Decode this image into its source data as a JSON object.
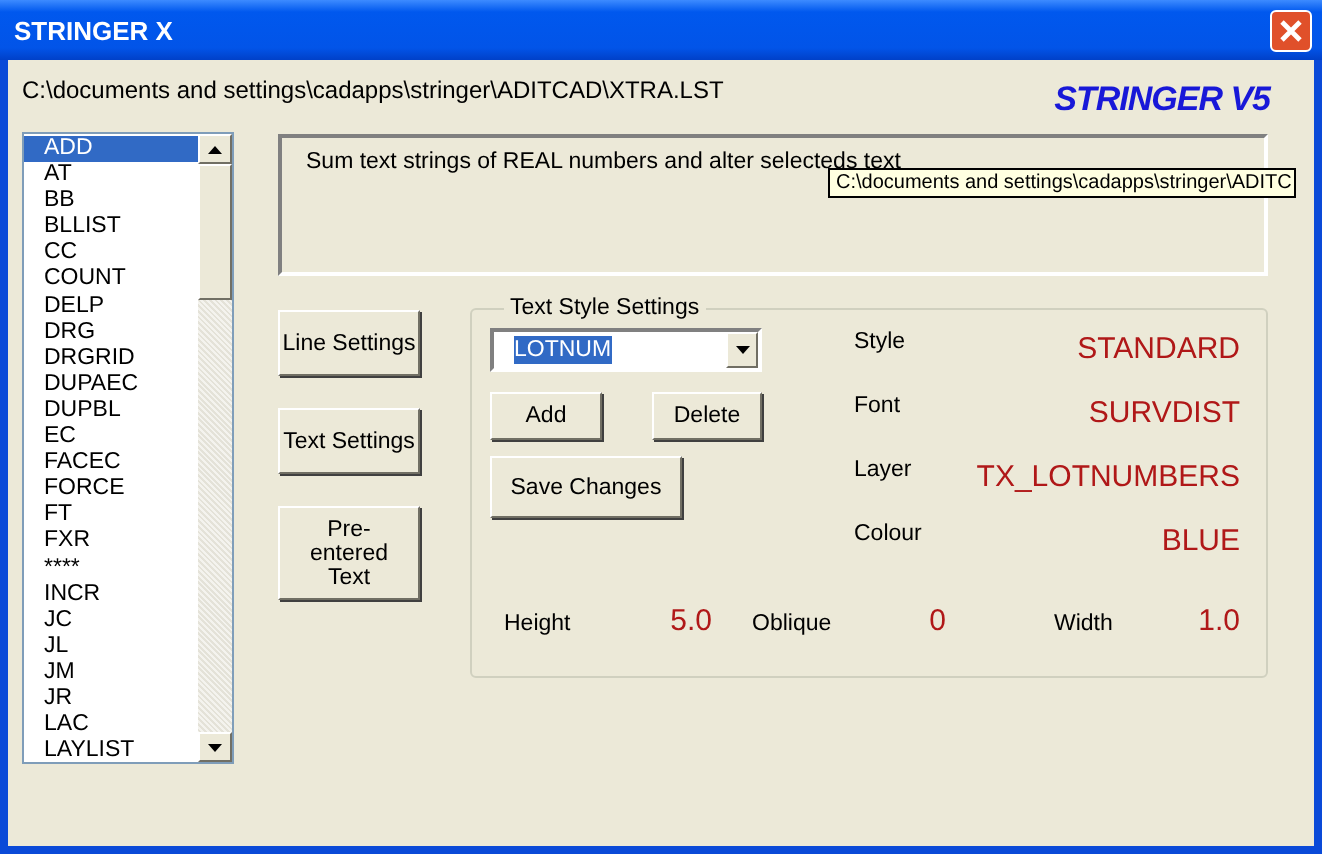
{
  "window": {
    "title": "STRINGER X"
  },
  "file_path": "C:\\documents and settings\\cadapps\\stringer\\ADITCAD\\XTRA.LST",
  "logo": "STRINGER V5",
  "commands": [
    {
      "label": "ADD",
      "selected": true
    },
    {
      "label": "AT",
      "selected": false
    },
    {
      "label": "BB",
      "selected": false
    },
    {
      "label": "BLLIST",
      "selected": false
    },
    {
      "label": "CC",
      "selected": false
    },
    {
      "label": "COUNT",
      "selected": false
    },
    {
      "label": "DELP",
      "selected": false
    },
    {
      "label": "DRG",
      "selected": false
    },
    {
      "label": "DRGRID",
      "selected": false
    },
    {
      "label": "DUPAEC",
      "selected": false
    },
    {
      "label": "DUPBL",
      "selected": false
    },
    {
      "label": "EC",
      "selected": false
    },
    {
      "label": "FACEC",
      "selected": false
    },
    {
      "label": "FORCE",
      "selected": false
    },
    {
      "label": "FT",
      "selected": false
    },
    {
      "label": "FXR",
      "selected": false
    },
    {
      "label": "****",
      "selected": false
    },
    {
      "label": "INCR",
      "selected": false
    },
    {
      "label": "JC",
      "selected": false
    },
    {
      "label": "JL",
      "selected": false
    },
    {
      "label": "JM",
      "selected": false
    },
    {
      "label": "JR",
      "selected": false
    },
    {
      "label": "LAC",
      "selected": false
    },
    {
      "label": "LAYLIST",
      "selected": false
    }
  ],
  "description": "Sum text strings of REAL numbers and alter selecteds text",
  "tooltip": "C:\\documents and settings\\cadapps\\stringer\\ADITC",
  "side_buttons": [
    "Line Settings",
    "Text Settings",
    "Pre-entered Text"
  ],
  "text_style": {
    "title": "Text Style Settings",
    "style_name": "LOTNUM",
    "buttons": [
      "Add",
      "Delete",
      "Save Changes"
    ],
    "properties": [
      {
        "label": "Style",
        "value": "STANDARD"
      },
      {
        "label": "Font",
        "value": "SURVDIST"
      },
      {
        "label": "Layer",
        "value": "TX_LOTNUMBERS"
      },
      {
        "label": "Colour",
        "value": "BLUE"
      }
    ],
    "metrics": [
      {
        "label": "Height",
        "value": "5.0"
      },
      {
        "label": "Oblique",
        "value": "0"
      },
      {
        "label": "Width",
        "value": "1.0"
      }
    ]
  }
}
